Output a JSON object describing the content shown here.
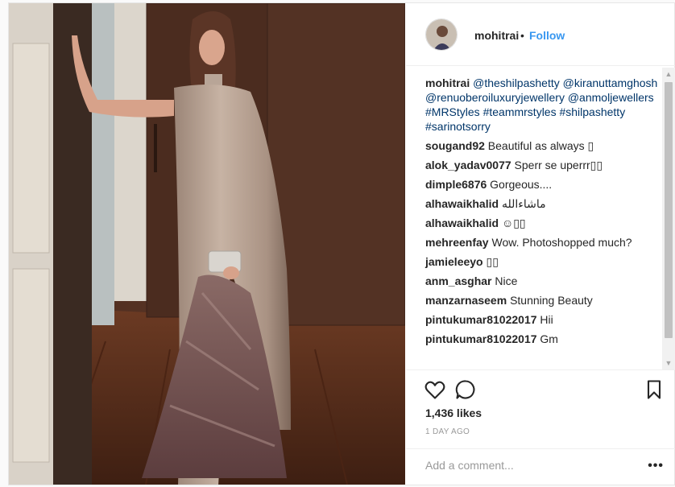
{
  "post": {
    "author": {
      "username": "mohitrai",
      "separator": "•",
      "follow_label": "Follow"
    },
    "caption": {
      "username": "mohitrai",
      "text": "@theshilpashetty @kiranuttamghosh @renuoberoiluxuryjewellery @anmoljewellers #MRStyles #teammrstyles #shilpashetty #sarinotsorry"
    },
    "comments": [
      {
        "username": "sougand92",
        "text": "Beautiful as always ▯"
      },
      {
        "username": "alok_yadav0077",
        "text": "Sperr se uperrr▯▯"
      },
      {
        "username": "dimple6876",
        "text": "Gorgeous...."
      },
      {
        "username": "alhawaikhalid",
        "text": "ماشاءالله"
      },
      {
        "username": "alhawaikhalid",
        "text": "☺▯▯"
      },
      {
        "username": "mehreenfay",
        "text": "Wow. Photoshopped much?"
      },
      {
        "username": "jamieleeyo",
        "text": "▯▯"
      },
      {
        "username": "anm_asghar",
        "text": "Nice"
      },
      {
        "username": "manzarnaseem",
        "text": "Stunning Beauty"
      },
      {
        "username": "pintukumar81022017",
        "text": "Hii"
      },
      {
        "username": "pintukumar81022017",
        "text": "Gm"
      }
    ],
    "scrollbar": {
      "up": "▲",
      "down": "▼"
    },
    "actions": {
      "icons": [
        "heart-icon",
        "comment-icon",
        "bookmark-icon"
      ],
      "likes": "1,436 likes",
      "time_ago": "1 DAY AGO"
    },
    "add_comment": {
      "placeholder": "Add a comment...",
      "more_label": "•••"
    },
    "colors": {
      "follow": "#3897f0",
      "hashtag": "#003569",
      "muted": "#999999"
    }
  }
}
